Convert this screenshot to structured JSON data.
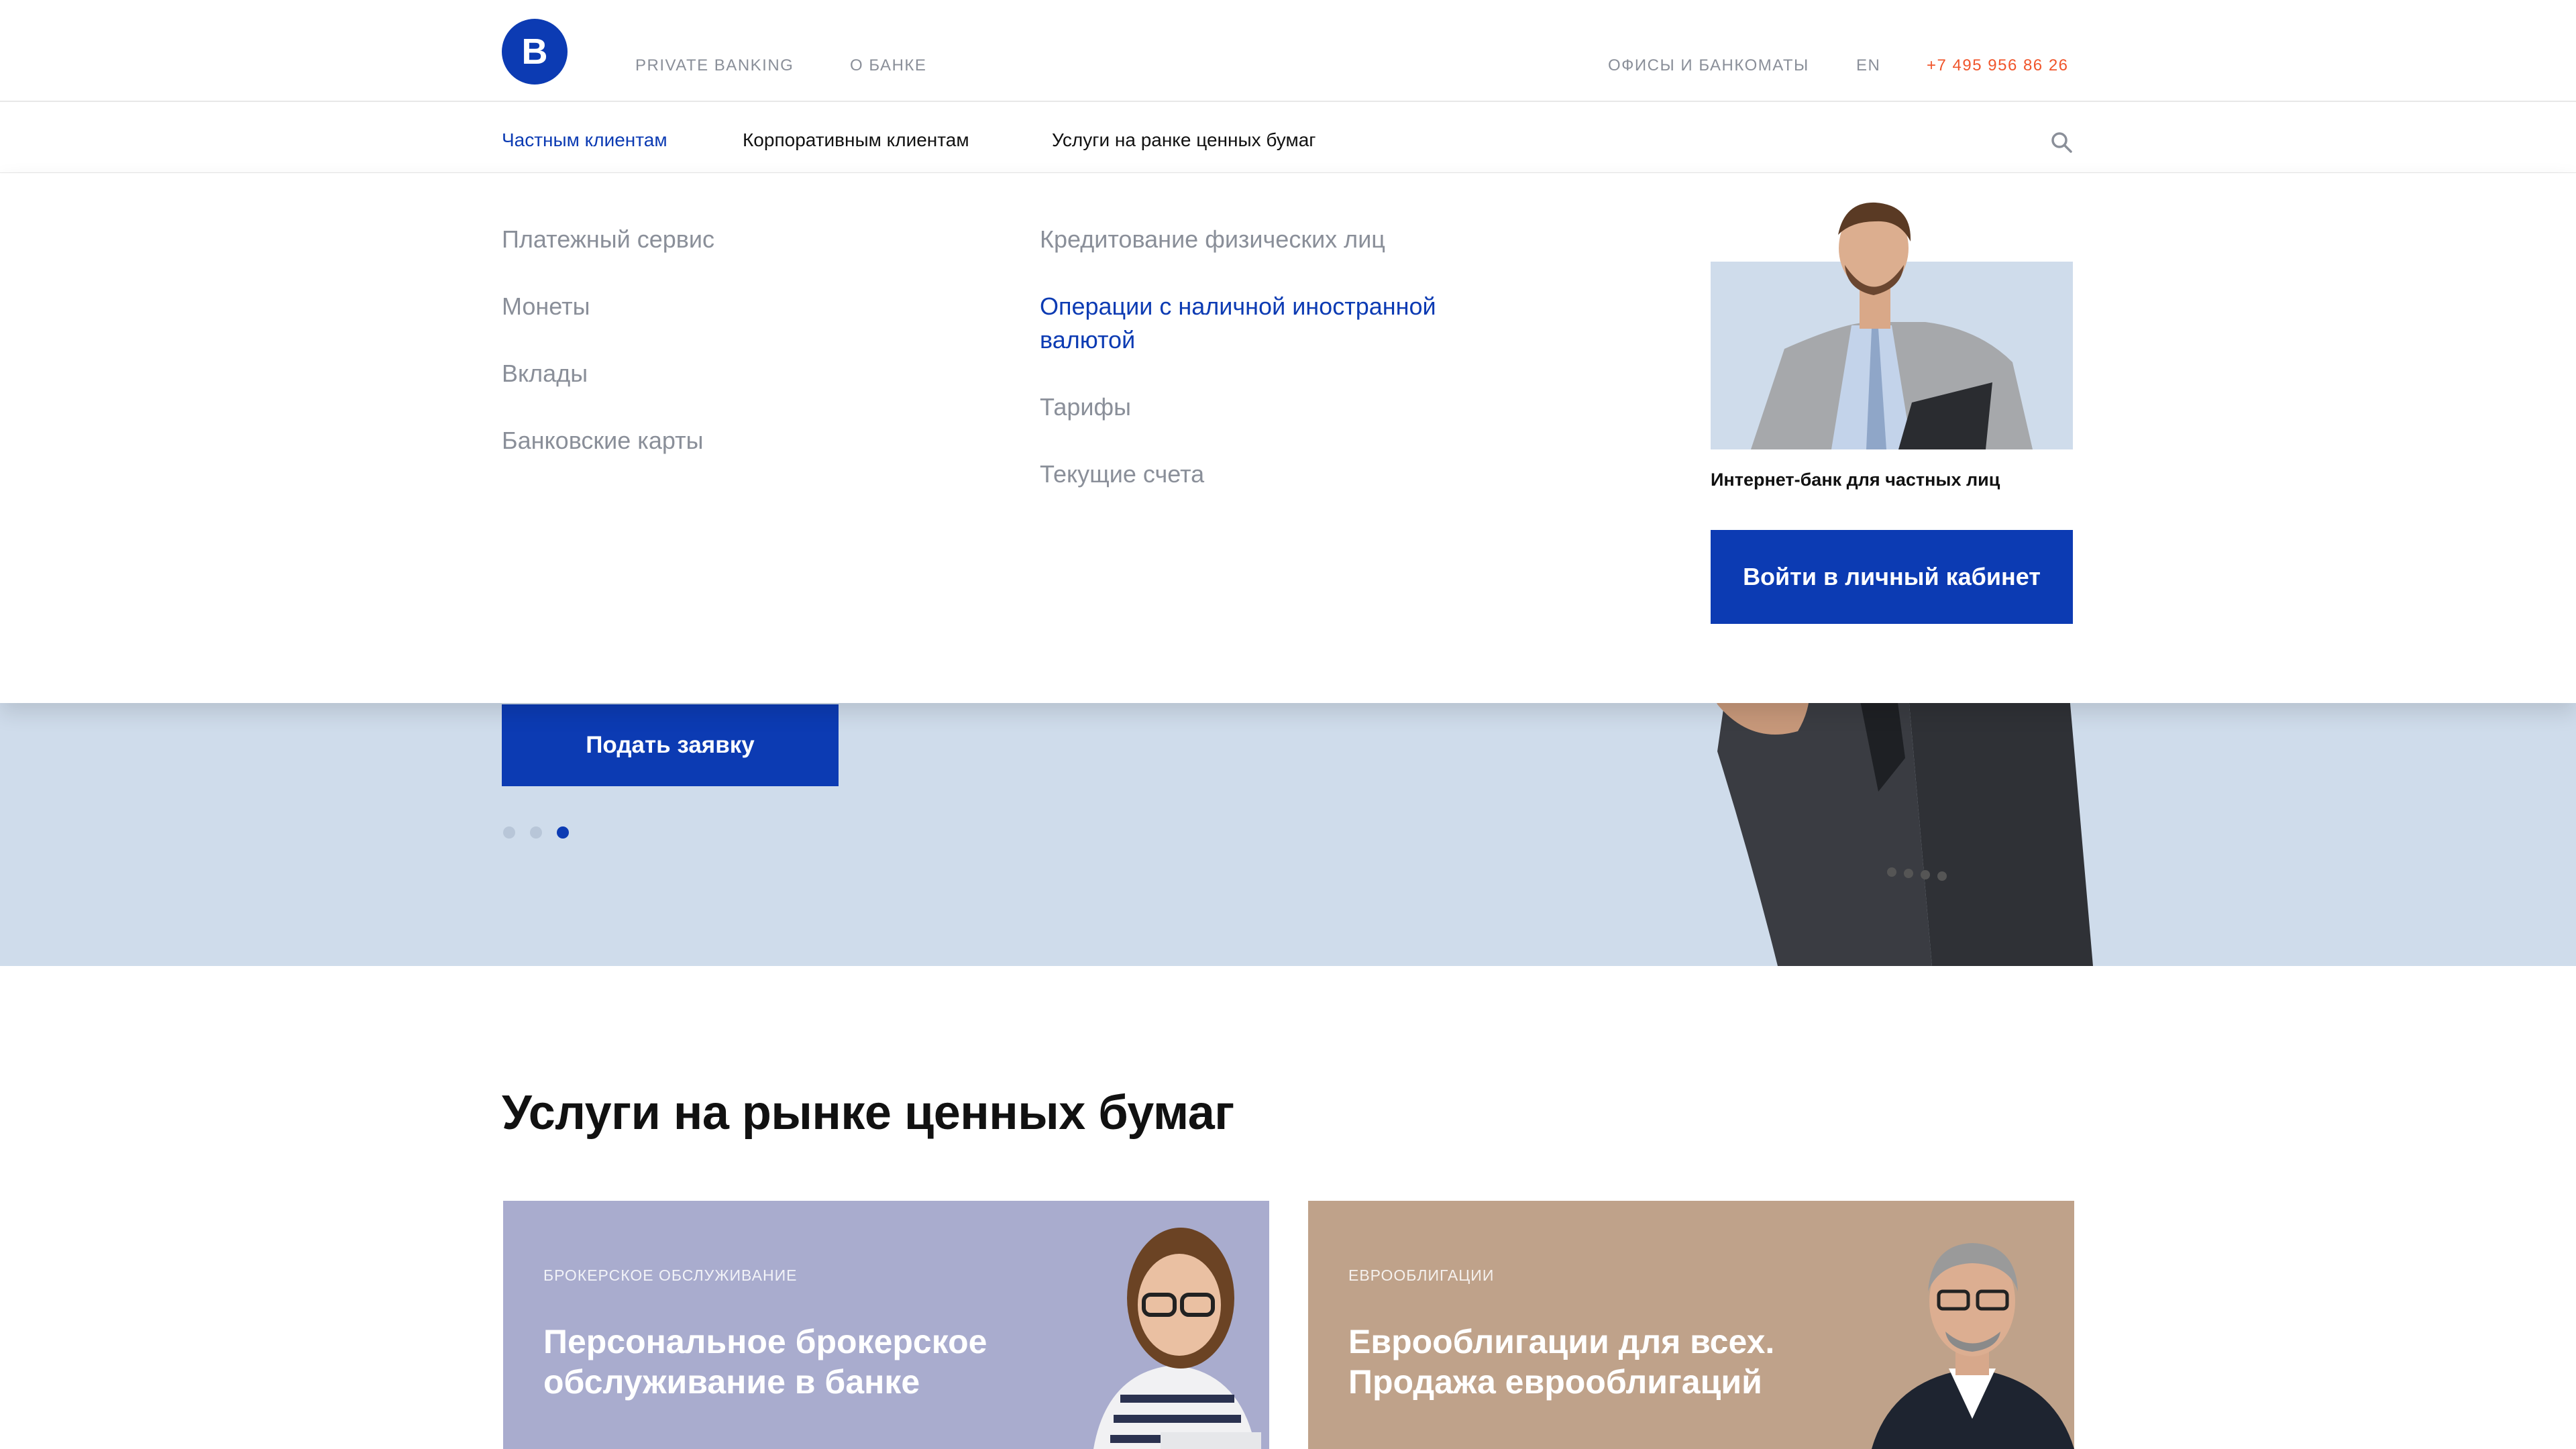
{
  "topbar": {
    "logo_letter": "B",
    "links": [
      "PRIVATE BANKING",
      "О БАНКЕ"
    ],
    "offices": "ОФИСЫ И БАНКОМАТЫ",
    "lang": "EN",
    "phone": "+7 495 956 86 26"
  },
  "nav": {
    "items": [
      "Частным клиентам",
      "Корпоративным клиентам",
      "Услуги на ранке ценных бумаг"
    ]
  },
  "dropdown": {
    "col1": [
      "Платежный сервис",
      "Монеты",
      "Вклады",
      "Банковские карты"
    ],
    "col2": [
      "Кредитование физических лиц",
      "Операции с наличной иностранной валютой",
      "Тарифы",
      "Текущие счета"
    ],
    "promo_caption": "Интернет-банк для частных лиц",
    "login_button": "Войти в личный кабинет"
  },
  "hero": {
    "apply_button": "Подать заявку",
    "slides_total": 3,
    "slide_active": 3
  },
  "section": {
    "title": "Услуги на рынке ценных бумаг",
    "cards": [
      {
        "tag": "БРОКЕРСКОЕ ОБСЛУЖИВАНИЕ",
        "title": "Персональное брокерское обслуживание в банке"
      },
      {
        "tag": "ЕВРООБЛИГАЦИИ",
        "title": "Еврооблигации для всех. Продажа еврооблигаций"
      }
    ]
  },
  "colors": {
    "brand_blue": "#0c3bb3",
    "phone_orange": "#f0552b",
    "hero_bg": "#cfdceb",
    "card1_bg": "#a9acce",
    "card2_bg": "#bfa28a"
  },
  "icons": {
    "search": "search-icon"
  }
}
